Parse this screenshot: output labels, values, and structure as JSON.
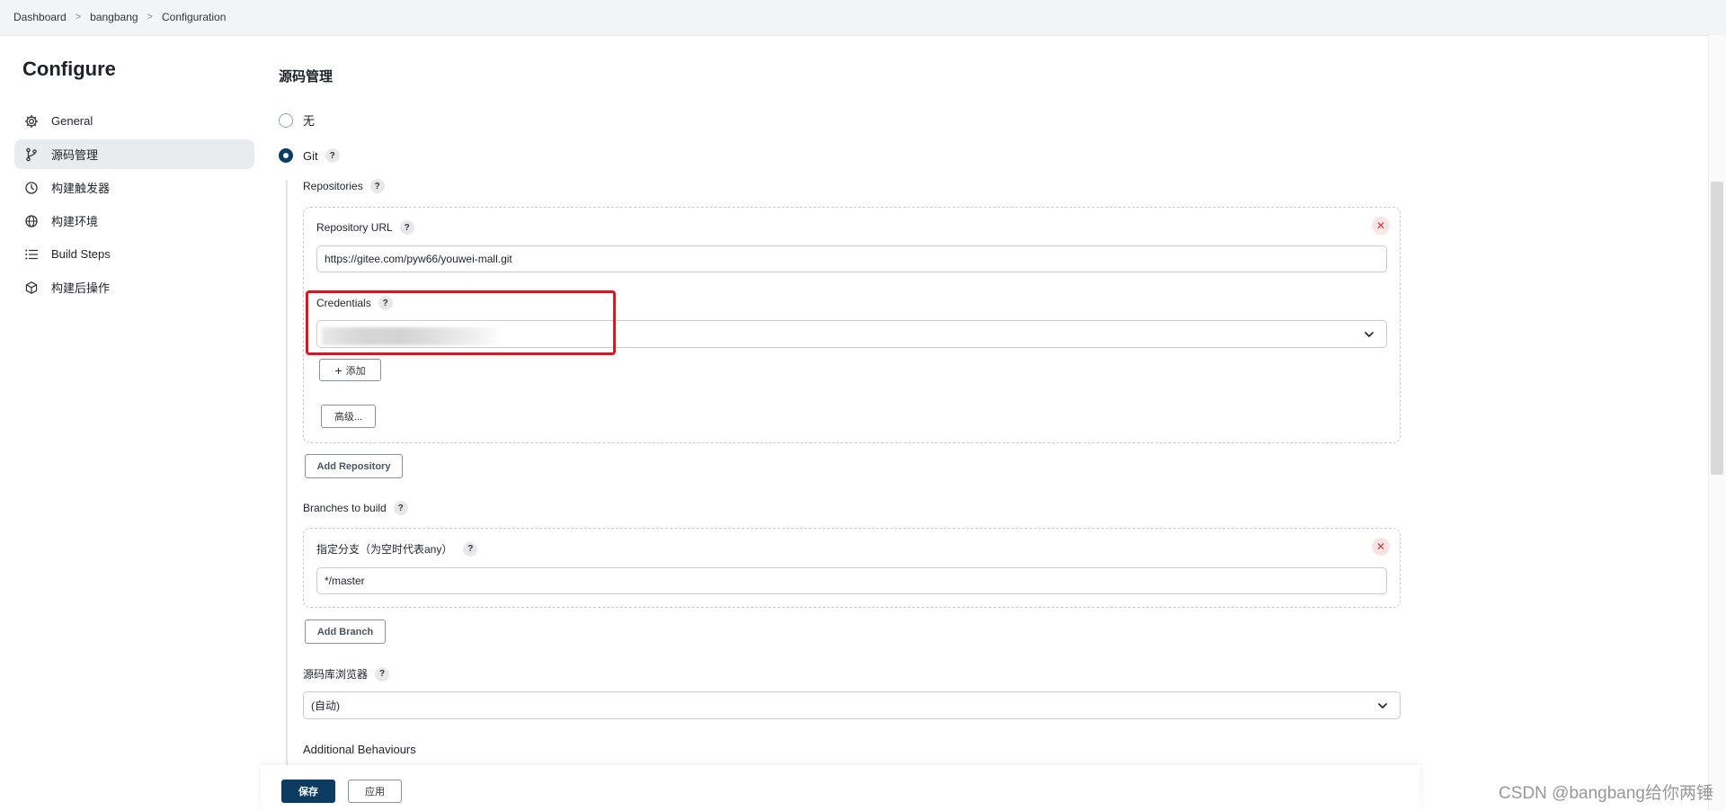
{
  "breadcrumb": {
    "items": [
      "Dashboard",
      "bangbang",
      "Configuration"
    ],
    "separator": ">"
  },
  "sidebar": {
    "title": "Configure",
    "items": [
      {
        "label": "General",
        "icon": "gear-icon"
      },
      {
        "label": "源码管理",
        "icon": "git-branch-icon",
        "active": true
      },
      {
        "label": "构建触发器",
        "icon": "clock-icon"
      },
      {
        "label": "构建环境",
        "icon": "globe-icon"
      },
      {
        "label": "Build Steps",
        "icon": "list-icon"
      },
      {
        "label": "构建后操作",
        "icon": "cube-icon"
      }
    ]
  },
  "scm": {
    "title": "源码管理",
    "options": [
      {
        "label": "无",
        "selected": false
      },
      {
        "label": "Git",
        "selected": true
      }
    ],
    "help": "?",
    "repositories_label": "Repositories",
    "repository_url_label": "Repository URL",
    "repository_url_value": "https://gitee.com/pyw66/youwei-mall.git",
    "credentials_label": "Credentials",
    "add_button": "添加",
    "advanced_button": "高级...",
    "add_repository_button": "Add Repository",
    "branches_label": "Branches to build",
    "branch_specifier_label": "指定分支（为空时代表any）",
    "branch_value": "*/master",
    "add_branch_button": "Add Branch",
    "repo_browser_label": "源码库浏览器",
    "repo_browser_value": "(自动)",
    "additional_behaviours_label": "Additional Behaviours"
  },
  "footer": {
    "save": "保存",
    "apply": "应用"
  },
  "watermark": "CSDN @bangbang给你两锤",
  "colors": {
    "primary": "#0b3d62",
    "highlight": "#e4121f",
    "remove": "#d33"
  }
}
